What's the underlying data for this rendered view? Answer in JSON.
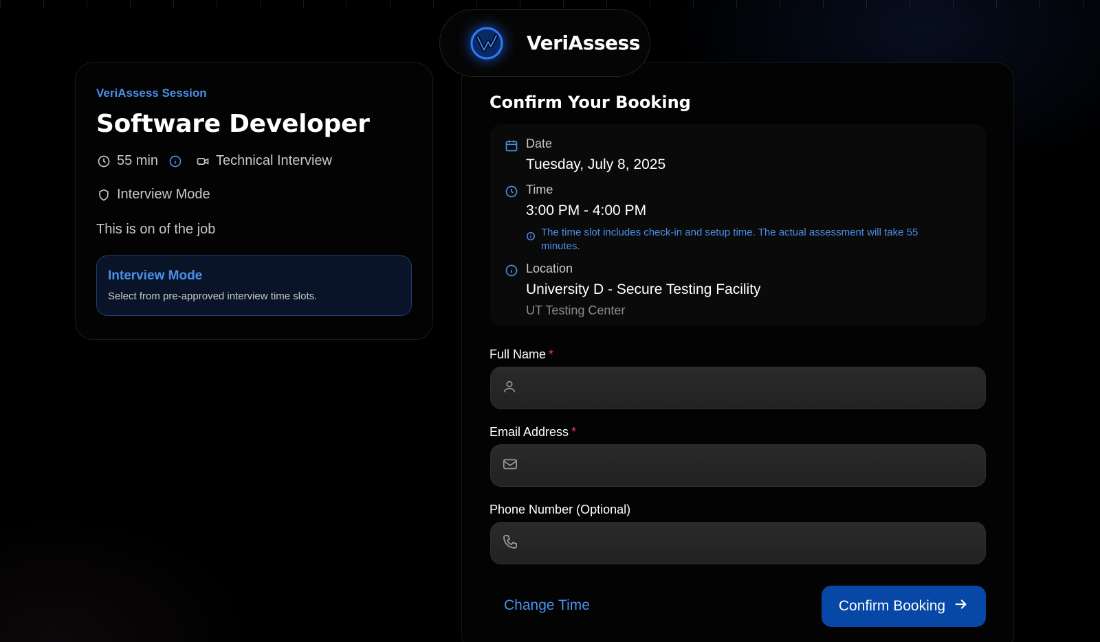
{
  "brand": {
    "name": "VeriAssess"
  },
  "session": {
    "label": "VeriAssess Session",
    "title": "Software Developer",
    "duration": "55 min",
    "type": "Technical Interview",
    "mode": "Interview Mode",
    "description": "This is on of the job",
    "mode_box": {
      "title": "Interview Mode",
      "text": "Select from pre-approved interview time slots."
    }
  },
  "booking": {
    "title": "Confirm Your Booking",
    "date": {
      "label": "Date",
      "value": "Tuesday, July 8, 2025"
    },
    "time": {
      "label": "Time",
      "value": "3:00 PM - 4:00 PM",
      "note": "The time slot includes check-in and setup time. The actual assessment will take 55 minutes."
    },
    "location": {
      "label": "Location",
      "value": "University D - Secure Testing Facility",
      "sub": "UT Testing Center"
    }
  },
  "form": {
    "full_name": {
      "label": "Full Name",
      "required_mark": "*",
      "value": "",
      "placeholder": ""
    },
    "email": {
      "label": "Email Address",
      "required_mark": "*",
      "value": "",
      "placeholder": ""
    },
    "phone": {
      "label": "Phone Number (Optional)",
      "value": "",
      "placeholder": ""
    }
  },
  "actions": {
    "change_time": "Change Time",
    "confirm": "Confirm Booking"
  },
  "colors": {
    "accent": "#4a8fe8",
    "button": "#0747a6",
    "required": "#e5484d",
    "background": "#000000"
  }
}
